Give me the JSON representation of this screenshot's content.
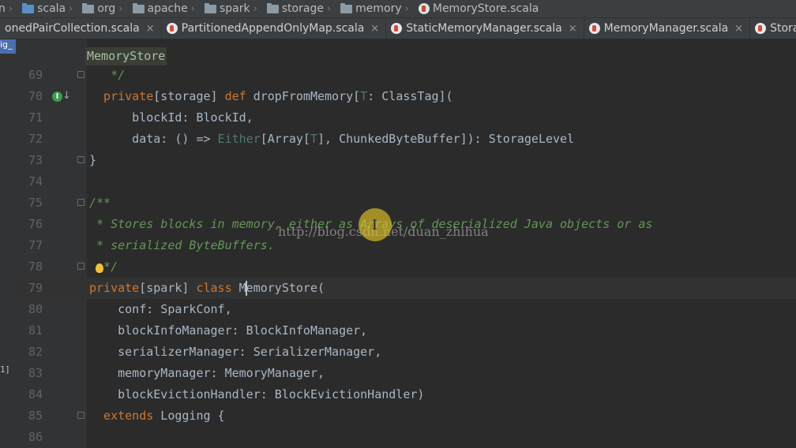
{
  "breadcrumb": {
    "items": [
      {
        "label": "n",
        "icon": "none"
      },
      {
        "label": "scala",
        "icon": "folder-blue-icon"
      },
      {
        "label": "org",
        "icon": "folder-icon"
      },
      {
        "label": "apache",
        "icon": "folder-icon"
      },
      {
        "label": "spark",
        "icon": "folder-icon"
      },
      {
        "label": "storage",
        "icon": "folder-icon"
      },
      {
        "label": "memory",
        "icon": "folder-icon"
      },
      {
        "label": "MemoryStore.scala",
        "icon": "scala-file-icon"
      }
    ]
  },
  "tabs": [
    {
      "label": "onedPairCollection.scala",
      "close": "×"
    },
    {
      "label": "PartitionedAppendOnlyMap.scala",
      "close": "×"
    },
    {
      "label": "StaticMemoryManager.scala",
      "close": "×"
    },
    {
      "label": "MemoryManager.scala",
      "close": "×"
    },
    {
      "label": "StorageM",
      "close": ""
    }
  ],
  "left_strip": {
    "top_label": "ig_",
    "bottom_label": "1]"
  },
  "editor": {
    "context_hint": "MemoryStore",
    "implements_marker": "I",
    "watermark": "http://blog.csdn.net/duan_zhihua",
    "lines": [
      {
        "n": "69",
        "indent": 3,
        "parts": [
          {
            "t": "*/",
            "c": "doc"
          }
        ]
      },
      {
        "n": "70",
        "indent": 2,
        "parts": [
          {
            "t": "private",
            "c": "kw"
          },
          {
            "t": "[storage] ",
            "c": "p"
          },
          {
            "t": "def ",
            "c": "kw"
          },
          {
            "t": "dropFromMemory[",
            "c": "p"
          },
          {
            "t": "T",
            "c": "tp"
          },
          {
            "t": ": ClassTag](",
            "c": "p"
          }
        ]
      },
      {
        "n": "71",
        "indent": 6,
        "parts": [
          {
            "t": "blockId: BlockId,",
            "c": "p"
          }
        ]
      },
      {
        "n": "72",
        "indent": 6,
        "parts": [
          {
            "t": "data: () => ",
            "c": "p"
          },
          {
            "t": "Either",
            "c": "tp"
          },
          {
            "t": "[Array[",
            "c": "p"
          },
          {
            "t": "T",
            "c": "tp"
          },
          {
            "t": "], ChunkedByteBuffer]): StorageLevel",
            "c": "p"
          }
        ]
      },
      {
        "n": "73",
        "indent": 0,
        "parts": [
          {
            "t": "}",
            "c": "p"
          }
        ]
      },
      {
        "n": "74",
        "indent": 0,
        "parts": []
      },
      {
        "n": "75",
        "indent": 0,
        "parts": [
          {
            "t": "/**",
            "c": "doc"
          }
        ]
      },
      {
        "n": "76",
        "indent": 1,
        "parts": [
          {
            "t": "* Stores blocks in memory, either as Arrays of deserialized Java objects or as",
            "c": "doc"
          }
        ]
      },
      {
        "n": "77",
        "indent": 1,
        "parts": [
          {
            "t": "* serialized ByteBuffers.",
            "c": "doc"
          }
        ]
      },
      {
        "n": "78",
        "indent": 1,
        "parts": [
          {
            "t": " */",
            "c": "doc"
          }
        ]
      },
      {
        "n": "79",
        "indent": 0,
        "parts": [
          {
            "t": "private",
            "c": "kw"
          },
          {
            "t": "[spark] ",
            "c": "p"
          },
          {
            "t": "class ",
            "c": "kw"
          },
          {
            "t": "MemoryStore(",
            "c": "p"
          }
        ]
      },
      {
        "n": "80",
        "indent": 4,
        "parts": [
          {
            "t": "conf: SparkConf,",
            "c": "p"
          }
        ]
      },
      {
        "n": "81",
        "indent": 4,
        "parts": [
          {
            "t": "blockInfoManager: BlockInfoManager,",
            "c": "p"
          }
        ]
      },
      {
        "n": "82",
        "indent": 4,
        "parts": [
          {
            "t": "serializerManager: SerializerManager,",
            "c": "p"
          }
        ]
      },
      {
        "n": "83",
        "indent": 4,
        "parts": [
          {
            "t": "memoryManager: MemoryManager,",
            "c": "p"
          }
        ]
      },
      {
        "n": "84",
        "indent": 4,
        "parts": [
          {
            "t": "blockEvictionHandler: BlockEvictionHandler)",
            "c": "p"
          }
        ]
      },
      {
        "n": "85",
        "indent": 2,
        "parts": [
          {
            "t": "extends ",
            "c": "kw"
          },
          {
            "t": "Logging {",
            "c": "p"
          }
        ]
      },
      {
        "n": "86",
        "indent": 0,
        "parts": []
      }
    ]
  }
}
